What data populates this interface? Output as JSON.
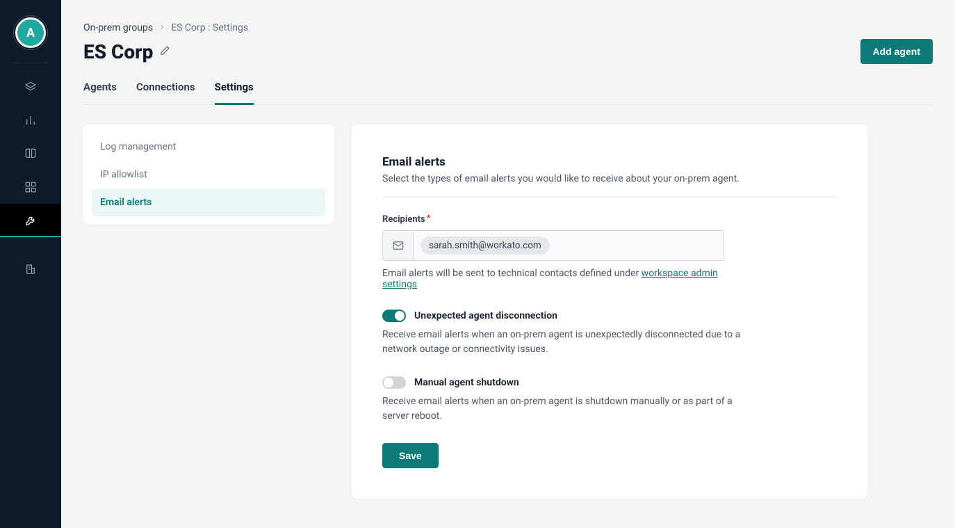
{
  "avatar": {
    "letter": "A"
  },
  "breadcrumb": {
    "root": "On-prem groups",
    "current": "ES Corp : Settings"
  },
  "header": {
    "title": "ES Corp",
    "add_agent_label": "Add agent"
  },
  "tabs": {
    "items": [
      {
        "label": "Agents"
      },
      {
        "label": "Connections"
      },
      {
        "label": "Settings"
      }
    ]
  },
  "sidebar": {
    "items": [
      {
        "label": "Log management"
      },
      {
        "label": "IP allowlist"
      },
      {
        "label": "Email alerts"
      }
    ]
  },
  "form": {
    "section_title": "Email alerts",
    "section_sub": "Select the types of email alerts you would like to receive about your on-prem agent.",
    "recipients_label": "Recipients",
    "recipients_required": "*",
    "recipients_chip": "sarah.smith@workato.com",
    "help_prefix": "Email alerts will be sent to technical contacts defined under ",
    "help_link": "workspace admin settings",
    "toggles": [
      {
        "label": "Unexpected agent disconnection",
        "desc": "Receive email alerts when an on-prem agent is unexpectedly disconnected due to a network outage or connectivity issues.",
        "on": true
      },
      {
        "label": "Manual agent shutdown",
        "desc": "Receive email alerts when an on-prem agent is shutdown manually or as part of a server reboot.",
        "on": false
      }
    ],
    "save_label": "Save"
  }
}
